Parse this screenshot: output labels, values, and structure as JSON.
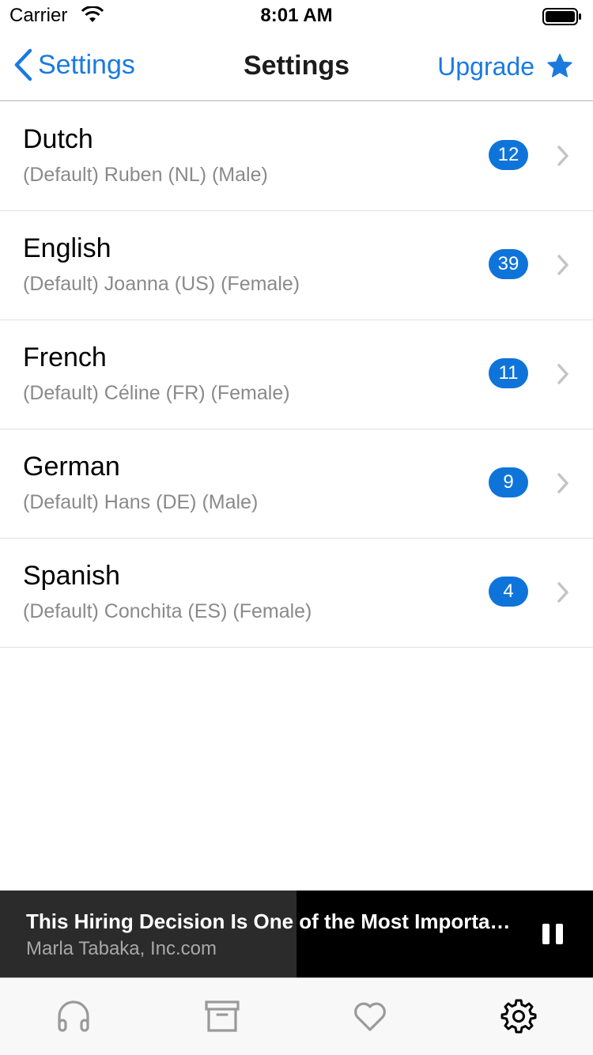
{
  "status_bar": {
    "carrier": "Carrier",
    "time": "8:01 AM"
  },
  "nav": {
    "back_label": "Settings",
    "title": "Settings",
    "upgrade_label": "Upgrade"
  },
  "languages": [
    {
      "name": "Dutch",
      "voice": "(Default) Ruben (NL) (Male)",
      "count": "12"
    },
    {
      "name": "English",
      "voice": "(Default) Joanna (US) (Female)",
      "count": "39"
    },
    {
      "name": "French",
      "voice": "(Default) Céline (FR) (Female)",
      "count": "11"
    },
    {
      "name": "German",
      "voice": "(Default) Hans (DE) (Male)",
      "count": "9"
    },
    {
      "name": "Spanish",
      "voice": "(Default) Conchita (ES) (Female)",
      "count": "4"
    }
  ],
  "now_playing": {
    "title": "This Hiring Decision Is One of the Most Important Decisions",
    "subtitle": "Marla Tabaka, Inc.com",
    "progress_fraction": 0.5
  },
  "tabs": [
    {
      "icon": "headphones-icon",
      "active": false
    },
    {
      "icon": "archive-icon",
      "active": false
    },
    {
      "icon": "heart-icon",
      "active": false
    },
    {
      "icon": "gear-icon",
      "active": true
    }
  ],
  "colors": {
    "accent": "#1a7ae0",
    "badge": "#0f74d9",
    "player_bg": "#000000",
    "player_progress": "#2b2b2b",
    "tab_inactive": "#9a9a9a",
    "tab_active": "#000000"
  }
}
